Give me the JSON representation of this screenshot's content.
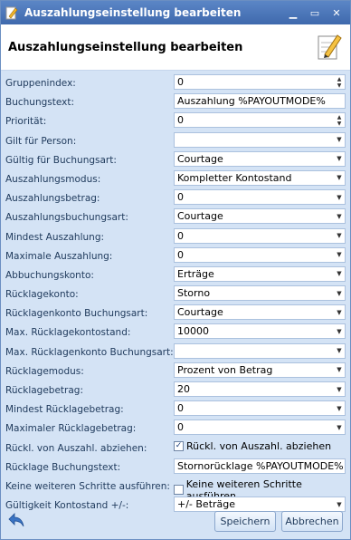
{
  "window": {
    "title": "Auszahlungseinstellung bearbeiten",
    "minimize_icon": "minimize-icon",
    "maximize_icon": "maximize-icon",
    "close_icon": "close-icon"
  },
  "header": {
    "title": "Auszahlungseinstellung bearbeiten"
  },
  "form": {
    "rows": [
      {
        "label": "Gruppenindex:",
        "type": "spin",
        "value": "0"
      },
      {
        "label": "Buchungstext:",
        "type": "text",
        "value": "Auszahlung %PAYOUTMODE%"
      },
      {
        "label": "Priorität:",
        "type": "spin",
        "value": "0"
      },
      {
        "label": "Gilt für Person:",
        "type": "select",
        "value": ""
      },
      {
        "label": "Gültig für Buchungsart:",
        "type": "select",
        "value": "Courtage"
      },
      {
        "label": "Auszahlungsmodus:",
        "type": "select",
        "value": "Kompletter Kontostand"
      },
      {
        "label": "Auszahlungsbetrag:",
        "type": "select",
        "value": "0"
      },
      {
        "label": "Auszahlungsbuchungsart:",
        "type": "select",
        "value": "Courtage"
      },
      {
        "label": "Mindest Auszahlung:",
        "type": "select",
        "value": "0"
      },
      {
        "label": "Maximale Auszahlung:",
        "type": "select",
        "value": "0"
      },
      {
        "label": "Abbuchungskonto:",
        "type": "select",
        "value": "Erträge"
      },
      {
        "label": "Rücklagekonto:",
        "type": "select",
        "value": "Storno"
      },
      {
        "label": "Rücklagenkonto Buchungsart:",
        "type": "select",
        "value": "Courtage"
      },
      {
        "label": "Max. Rücklagekontostand:",
        "type": "select",
        "value": "10000"
      },
      {
        "label": "Max. Rücklagenkonto Buchungsart:",
        "type": "select",
        "value": ""
      },
      {
        "label": "Rücklagemodus:",
        "type": "select",
        "value": "Prozent von Betrag"
      },
      {
        "label": "Rücklagebetrag:",
        "type": "select",
        "value": "20"
      },
      {
        "label": "Mindest Rücklagebetrag:",
        "type": "select",
        "value": "0"
      },
      {
        "label": "Maximaler Rücklagebetrag:",
        "type": "select",
        "value": "0"
      },
      {
        "label": "Rückl. von Auszahl. abziehen:",
        "type": "checkbox",
        "checked": true,
        "value": "Rückl. von Auszahl. abziehen"
      },
      {
        "label": "Rücklage Buchungstext:",
        "type": "text",
        "value": "Stornorücklage %PAYOUTMODE%"
      },
      {
        "label": "Keine weiteren Schritte ausführen:",
        "type": "checkbox",
        "checked": false,
        "value": "Keine weiteren Schritte ausführen"
      },
      {
        "label": "Gültigkeit Kontostand +/-:",
        "type": "select",
        "value": "+/- Beträge"
      }
    ]
  },
  "footer": {
    "back_icon": "back-arrow-icon",
    "save_label": "Speichern",
    "cancel_label": "Abbrechen"
  },
  "colors": {
    "titlebar": "#4a77bb",
    "background": "#d4e3f5",
    "field_border": "#abc1de"
  }
}
